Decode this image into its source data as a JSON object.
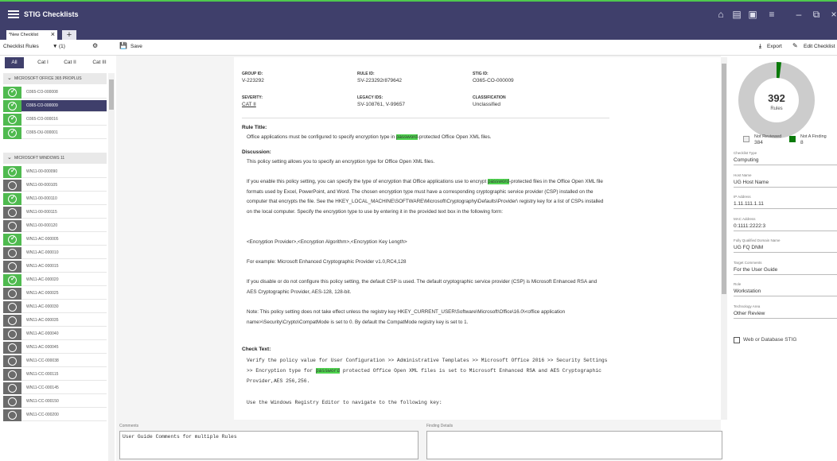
{
  "app": {
    "title": "STIG Checklists"
  },
  "tabs": [
    {
      "label": "*New Checklist"
    }
  ],
  "toolbar": {
    "rules_label": "Checklist Rules",
    "filter_count": "(1)",
    "save_label": "Save",
    "export_label": "Export",
    "edit_label": "Edit Checklist"
  },
  "categories": [
    "All",
    "Cat I",
    "Cat II",
    "Cat III"
  ],
  "groups": [
    {
      "name": "MICROSOFT OFFICE 365 PROPLUS"
    },
    {
      "name": "MICROSOFT WINDOWS 11"
    }
  ],
  "rules_office": [
    {
      "id": "O365-CO-000008",
      "status": "ok"
    },
    {
      "id": "O365-CO-000009",
      "status": "ok"
    },
    {
      "id": "O365-CO-000016",
      "status": "ok"
    },
    {
      "id": "O365-OU-000001",
      "status": "ok"
    }
  ],
  "rules_windows": [
    {
      "id": "WN11-00-000090",
      "status": "ok"
    },
    {
      "id": "WN11-00-000105",
      "status": "nr"
    },
    {
      "id": "WN11-00-000110",
      "status": "ok"
    },
    {
      "id": "WN11-00-000115",
      "status": "nr"
    },
    {
      "id": "WN11-00-000120",
      "status": "nr"
    },
    {
      "id": "WN11-AC-000005",
      "status": "ok"
    },
    {
      "id": "WN11-AC-000010",
      "status": "nr"
    },
    {
      "id": "WN11-AC-000015",
      "status": "nr"
    },
    {
      "id": "WN11-AC-000020",
      "status": "ok"
    },
    {
      "id": "WN11-AC-000025",
      "status": "nr"
    },
    {
      "id": "WN11-AC-000030",
      "status": "nr"
    },
    {
      "id": "WN11-AC-000035",
      "status": "nr"
    },
    {
      "id": "WN11-AC-000040",
      "status": "nr"
    },
    {
      "id": "WN11-AC-000045",
      "status": "nr"
    },
    {
      "id": "WN11-CC-000038",
      "status": "nr"
    },
    {
      "id": "WN11-CC-000115",
      "status": "nr"
    },
    {
      "id": "WN11-CC-000145",
      "status": "nr"
    },
    {
      "id": "WN11-CC-000150",
      "status": "nr"
    },
    {
      "id": "WN11-CC-000200",
      "status": "nr"
    }
  ],
  "detail": {
    "group_id_label": "GROUP ID:",
    "group_id": "V-223292",
    "rule_id_label": "RULE ID:",
    "rule_id": "SV-223292r879642",
    "stig_id_label": "STIG ID:",
    "stig_id": "O365-CO-000009",
    "severity_label": "SEVERITY:",
    "severity": "CAT II",
    "legacy_label": "LEGACY IDS:",
    "legacy": "SV-108761, V-99657",
    "class_label": "CLASSIFICATION",
    "classification": "Unclassified",
    "rule_title_label": "Rule Title:",
    "rule_title_pre": "Office applications must be configured to specify encryption type in ",
    "highlight": "password",
    "rule_title_post": "-protected Office Open XML files.",
    "discussion_label": "Discussion:",
    "disc1": "This policy setting allows you to specify an encryption type for Office Open XML files.",
    "disc2_pre": "If you enable this policy setting, you can specify the type of encryption that Office applications use to encrypt ",
    "disc2_post": "-protected files in the Office Open XML file formats used by Excel, PowerPoint, and Word. The chosen encryption type must have a corresponding cryptographic service provider (CSP) installed on the computer that encrypts the file. See the HKEY_LOCAL_MACHINE\\SOFTWARE\\Microsoft\\Cryptography\\Defaults\\Provider\\ registry key for a list of CSPs installed on the local computer. Specify the encryption type to use by entering it in the provided text box in the following form:",
    "disc3": "<Encryption Provider>,<Encryption Algorithm>,<Encryption Key Length>",
    "disc4": "For example: Microsoft Enhanced Cryptographic Provider v1.0,RC4,128",
    "disc5": "If you disable or do not configure this policy setting, the default CSP is used. The default cryptographic service provider (CSP) is Microsoft Enhanced RSA and AES Cryptographic Provider, AES-128, 128-bit.",
    "disc6": "Note: This policy setting does not take effect unless the registry key HKEY_CURRENT_USER\\Software\\Microsoft\\Office\\16.0\\<office application name>\\Security\\Crypto\\CompatMode is set to 0. By default the CompatMode registry key is set to 1.",
    "check_label": "Check Text:",
    "check1_pre": "Verify the policy value for User Configuration >> Administrative Templates >> Microsoft Office 2016 >> Security Settings >> Encryption type for ",
    "check1_post": " protected Office Open XML files is set to Microsoft Enhanced RSA and AES Cryptographic Provider,AES 256,256.",
    "check2": "Use the Windows Registry Editor to navigate to the following key:"
  },
  "bottom": {
    "comments_label": "Comments",
    "comments_value": "User Guide Comments for multiple Rules",
    "finding_label": "Finding Details",
    "finding_value": ""
  },
  "summary": {
    "total": "392",
    "total_label": "Rules",
    "not_reviewed_label": "Not Reviewed",
    "not_reviewed": "384",
    "not_finding_label": "Not A Finding",
    "not_finding": "8",
    "color_nr": "#cccccc",
    "color_nf": "#0a7a0a"
  },
  "meta": [
    {
      "label": "Checklist Type",
      "value": "Computing"
    },
    {
      "label": "Host Name",
      "value": "UG Host Name"
    },
    {
      "label": "IP Address",
      "value": "1.11.111.1.11"
    },
    {
      "label": "MAC Address",
      "value": "0:1111:2222:3"
    },
    {
      "label": "Fully Qualified Domain Name",
      "value": "UG FQ DNM"
    },
    {
      "label": "Target Comments",
      "value": "For the User Guide"
    },
    {
      "label": "Role",
      "value": "Workstation"
    },
    {
      "label": "Technology Area",
      "value": "Other Review"
    }
  ],
  "web_db_label": "Web or Database STIG"
}
